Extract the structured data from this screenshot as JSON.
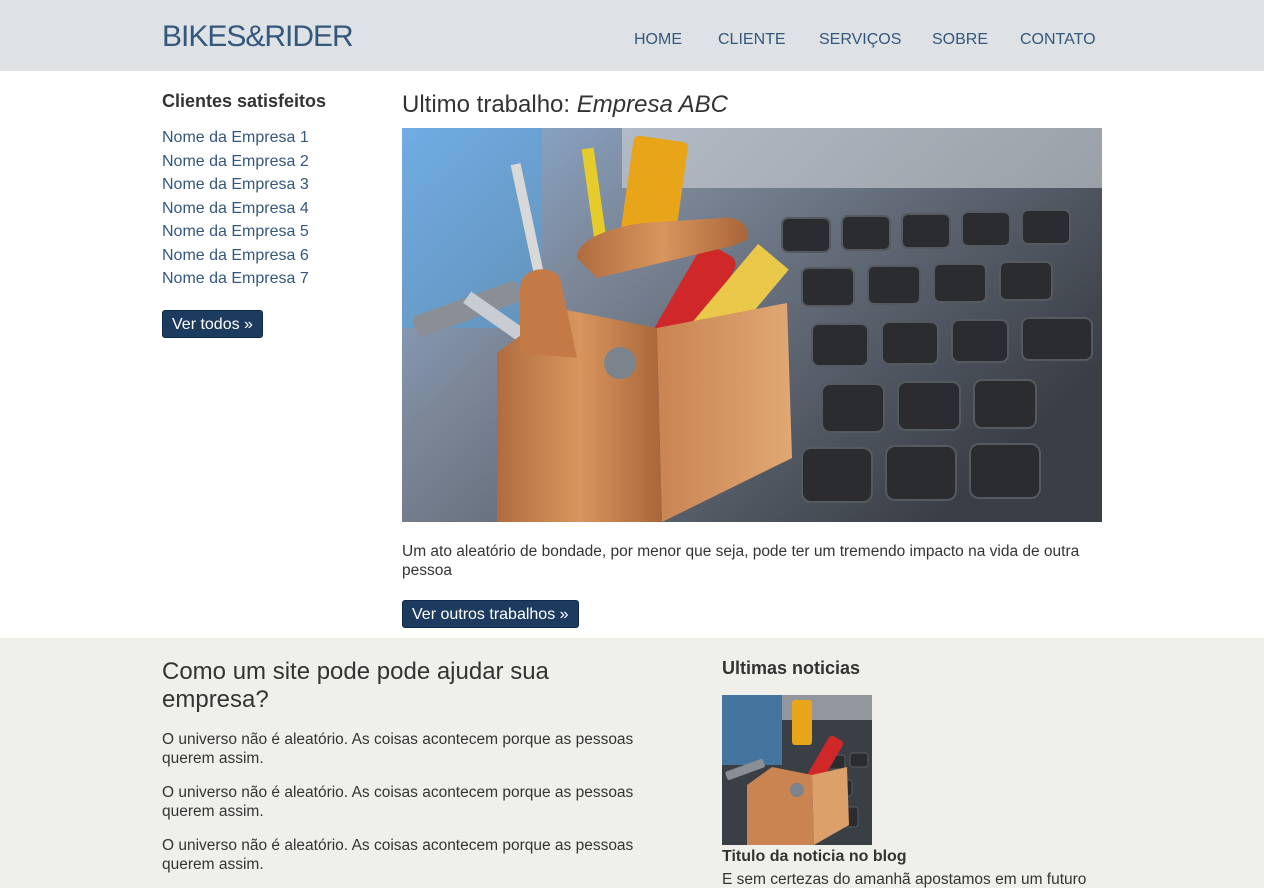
{
  "header": {
    "logo": "BIKES&RIDER",
    "nav": [
      "HOME",
      "CLIENTE",
      "SERVIÇOS",
      "SOBRE",
      "CONTATO"
    ]
  },
  "sidebar": {
    "title": "Clientes satisfeitos",
    "clients": [
      "Nome da Empresa 1",
      "Nome da Empresa 2",
      "Nome da Empresa 3",
      "Nome da Empresa 4",
      "Nome da Empresa 5",
      "Nome da Empresa 6",
      "Nome da Empresa 7"
    ],
    "button": "Ver todos »"
  },
  "main": {
    "title_prefix": "Ultimo trabalho: ",
    "title_em": "Empresa ABC",
    "image_icon": "toolbox-on-keyboard-image",
    "text": "Um ato aleatório de bondade, por menor que seja, pode ter um tremendo impacto na vida de outra pessoa",
    "button": "Ver outros trabalhos »"
  },
  "why": {
    "title": "Como um site pode pode ajudar sua empresa?",
    "paragraphs": [
      "O universo não é aleatório. As coisas acontecem porque as pessoas querem assim.",
      "O universo não é aleatório. As coisas acontecem porque as pessoas querem assim.",
      "O universo não é aleatório. As coisas acontecem porque as pessoas querem assim."
    ]
  },
  "news": {
    "title": "Ultimas noticias",
    "item_title": "Titulo da noticia no blog",
    "item_text": "E sem certezas do amanhã apostamos em um futuro"
  },
  "colors": {
    "header_bg": "#dee2e5",
    "link": "#34577e",
    "button_bg": "#1d3b5f",
    "bottom_bg": "#f0f0eb"
  }
}
